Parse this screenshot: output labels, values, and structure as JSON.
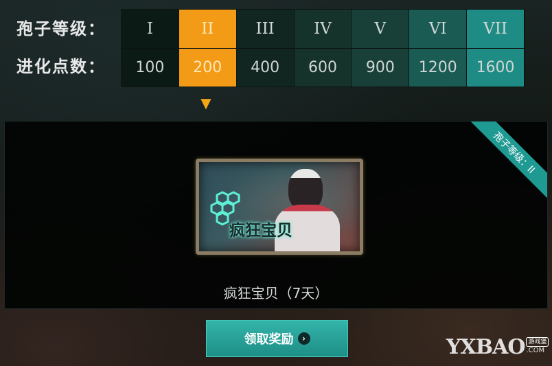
{
  "labels": {
    "level_row": "孢子等级：",
    "points_row": "进化点数："
  },
  "levels": [
    {
      "numeral": "I",
      "points": "100",
      "color": "#0c1a16"
    },
    {
      "numeral": "II",
      "points": "200",
      "color": "#f39b16"
    },
    {
      "numeral": "III",
      "points": "400",
      "color": "#112620"
    },
    {
      "numeral": "IV",
      "points": "600",
      "color": "#15322b"
    },
    {
      "numeral": "V",
      "points": "900",
      "color": "#184038"
    },
    {
      "numeral": "VI",
      "points": "1200",
      "color": "#1a5b54"
    },
    {
      "numeral": "VII",
      "points": "1600",
      "color": "#1e8c84"
    }
  ],
  "selected_level_index": 1,
  "reward": {
    "ribbon_text": "孢子等级：II",
    "card_text": "疯狂宝贝",
    "name": "疯狂宝贝（7天）"
  },
  "claim_button": {
    "label": "领取奖励"
  },
  "watermark": {
    "main": "YXBAO",
    "tag": "游戏堡",
    "com": ".COM"
  },
  "colors": {
    "accent_orange": "#f39b16",
    "accent_teal": "#1f9a92",
    "button_teal": "#2aa79c"
  }
}
